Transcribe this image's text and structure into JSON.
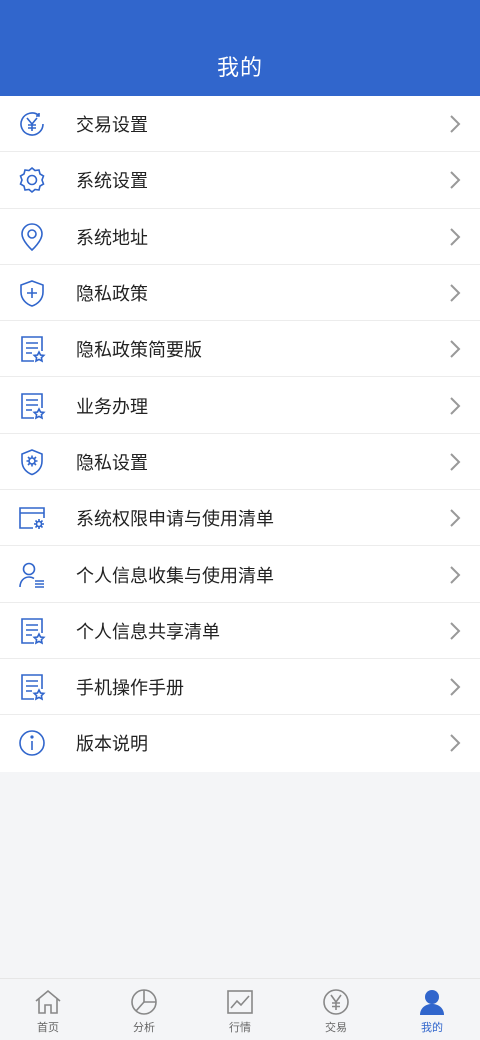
{
  "header": {
    "title": "我的"
  },
  "menu": [
    {
      "label": "交易设置",
      "icon": "yen-circle-icon"
    },
    {
      "label": "系统设置",
      "icon": "gear-icon"
    },
    {
      "label": "系统地址",
      "icon": "location-pin-icon"
    },
    {
      "label": "隐私政策",
      "icon": "shield-plus-icon"
    },
    {
      "label": "隐私政策简要版",
      "icon": "document-star-icon"
    },
    {
      "label": "业务办理",
      "icon": "document-star-icon"
    },
    {
      "label": "隐私设置",
      "icon": "shield-gear-icon"
    },
    {
      "label": "系统权限申请与使用清单",
      "icon": "window-gear-icon"
    },
    {
      "label": "个人信息收集与使用清单",
      "icon": "person-list-icon"
    },
    {
      "label": "个人信息共享清单",
      "icon": "document-star-icon"
    },
    {
      "label": "手机操作手册",
      "icon": "document-star-icon"
    },
    {
      "label": "版本说明",
      "icon": "info-circle-icon"
    }
  ],
  "tabbar": [
    {
      "label": "首页",
      "icon": "home-icon",
      "active": false
    },
    {
      "label": "分析",
      "icon": "pie-chart-icon",
      "active": false
    },
    {
      "label": "行情",
      "icon": "line-chart-icon",
      "active": false
    },
    {
      "label": "交易",
      "icon": "yen-circle-icon",
      "active": false
    },
    {
      "label": "我的",
      "icon": "user-icon",
      "active": true
    }
  ],
  "colors": {
    "primary": "#3166cc",
    "icon": "#3166cc",
    "chevron": "#999999",
    "tab_inactive": "#888888"
  }
}
